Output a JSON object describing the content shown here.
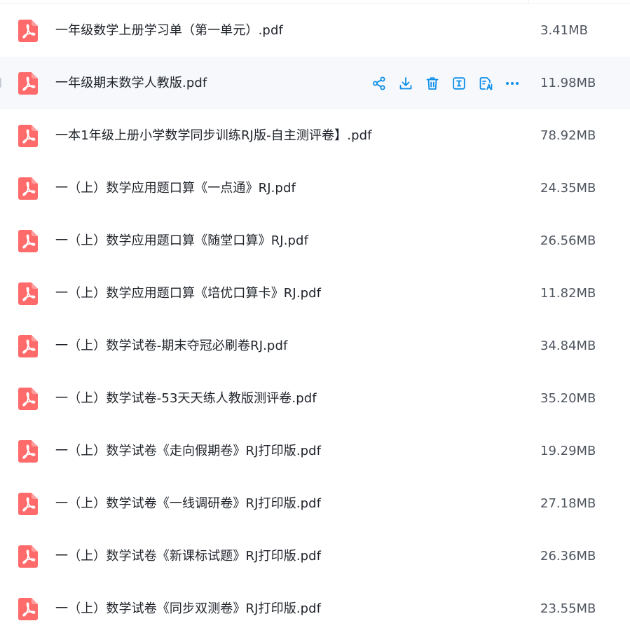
{
  "file_list": {
    "accent_color": "#0d8ee9",
    "pdf_icon_color": "#ff6b6b",
    "hovered_row_index": 1,
    "row_actions": [
      {
        "name": "share-icon"
      },
      {
        "name": "download-icon"
      },
      {
        "name": "delete-icon"
      },
      {
        "name": "rename-icon"
      },
      {
        "name": "convert-icon"
      },
      {
        "name": "more-icon"
      }
    ],
    "files": [
      {
        "name": "一年级数学上册学习单（第一单元）.pdf",
        "size": "3.41MB"
      },
      {
        "name": "一年级期末数学人教版.pdf",
        "size": "11.98MB"
      },
      {
        "name": "一本1年级上册小学数学同步训练RJ版-自主测评卷】.pdf",
        "size": "78.92MB"
      },
      {
        "name": "一（上）数学应用题口算《一点通》RJ.pdf",
        "size": "24.35MB"
      },
      {
        "name": "一（上）数学应用题口算《随堂口算》RJ.pdf",
        "size": "26.56MB"
      },
      {
        "name": "一（上）数学应用题口算《培优口算卡》RJ.pdf",
        "size": "11.82MB"
      },
      {
        "name": "一（上）数学试卷-期末夺冠必刷卷RJ.pdf",
        "size": "34.84MB"
      },
      {
        "name": "一（上）数学试卷-53天天练人教版测评卷.pdf",
        "size": "35.20MB"
      },
      {
        "name": "一（上）数学试卷《走向假期卷》RJ打印版.pdf",
        "size": "19.29MB"
      },
      {
        "name": "一（上）数学试卷《一线调研卷》RJ打印版.pdf",
        "size": "27.18MB"
      },
      {
        "name": "一（上）数学试卷《新课标试题》RJ打印版.pdf",
        "size": "26.36MB"
      },
      {
        "name": "一（上）数学试卷《同步双测卷》RJ打印版.pdf",
        "size": "23.55MB"
      }
    ]
  }
}
